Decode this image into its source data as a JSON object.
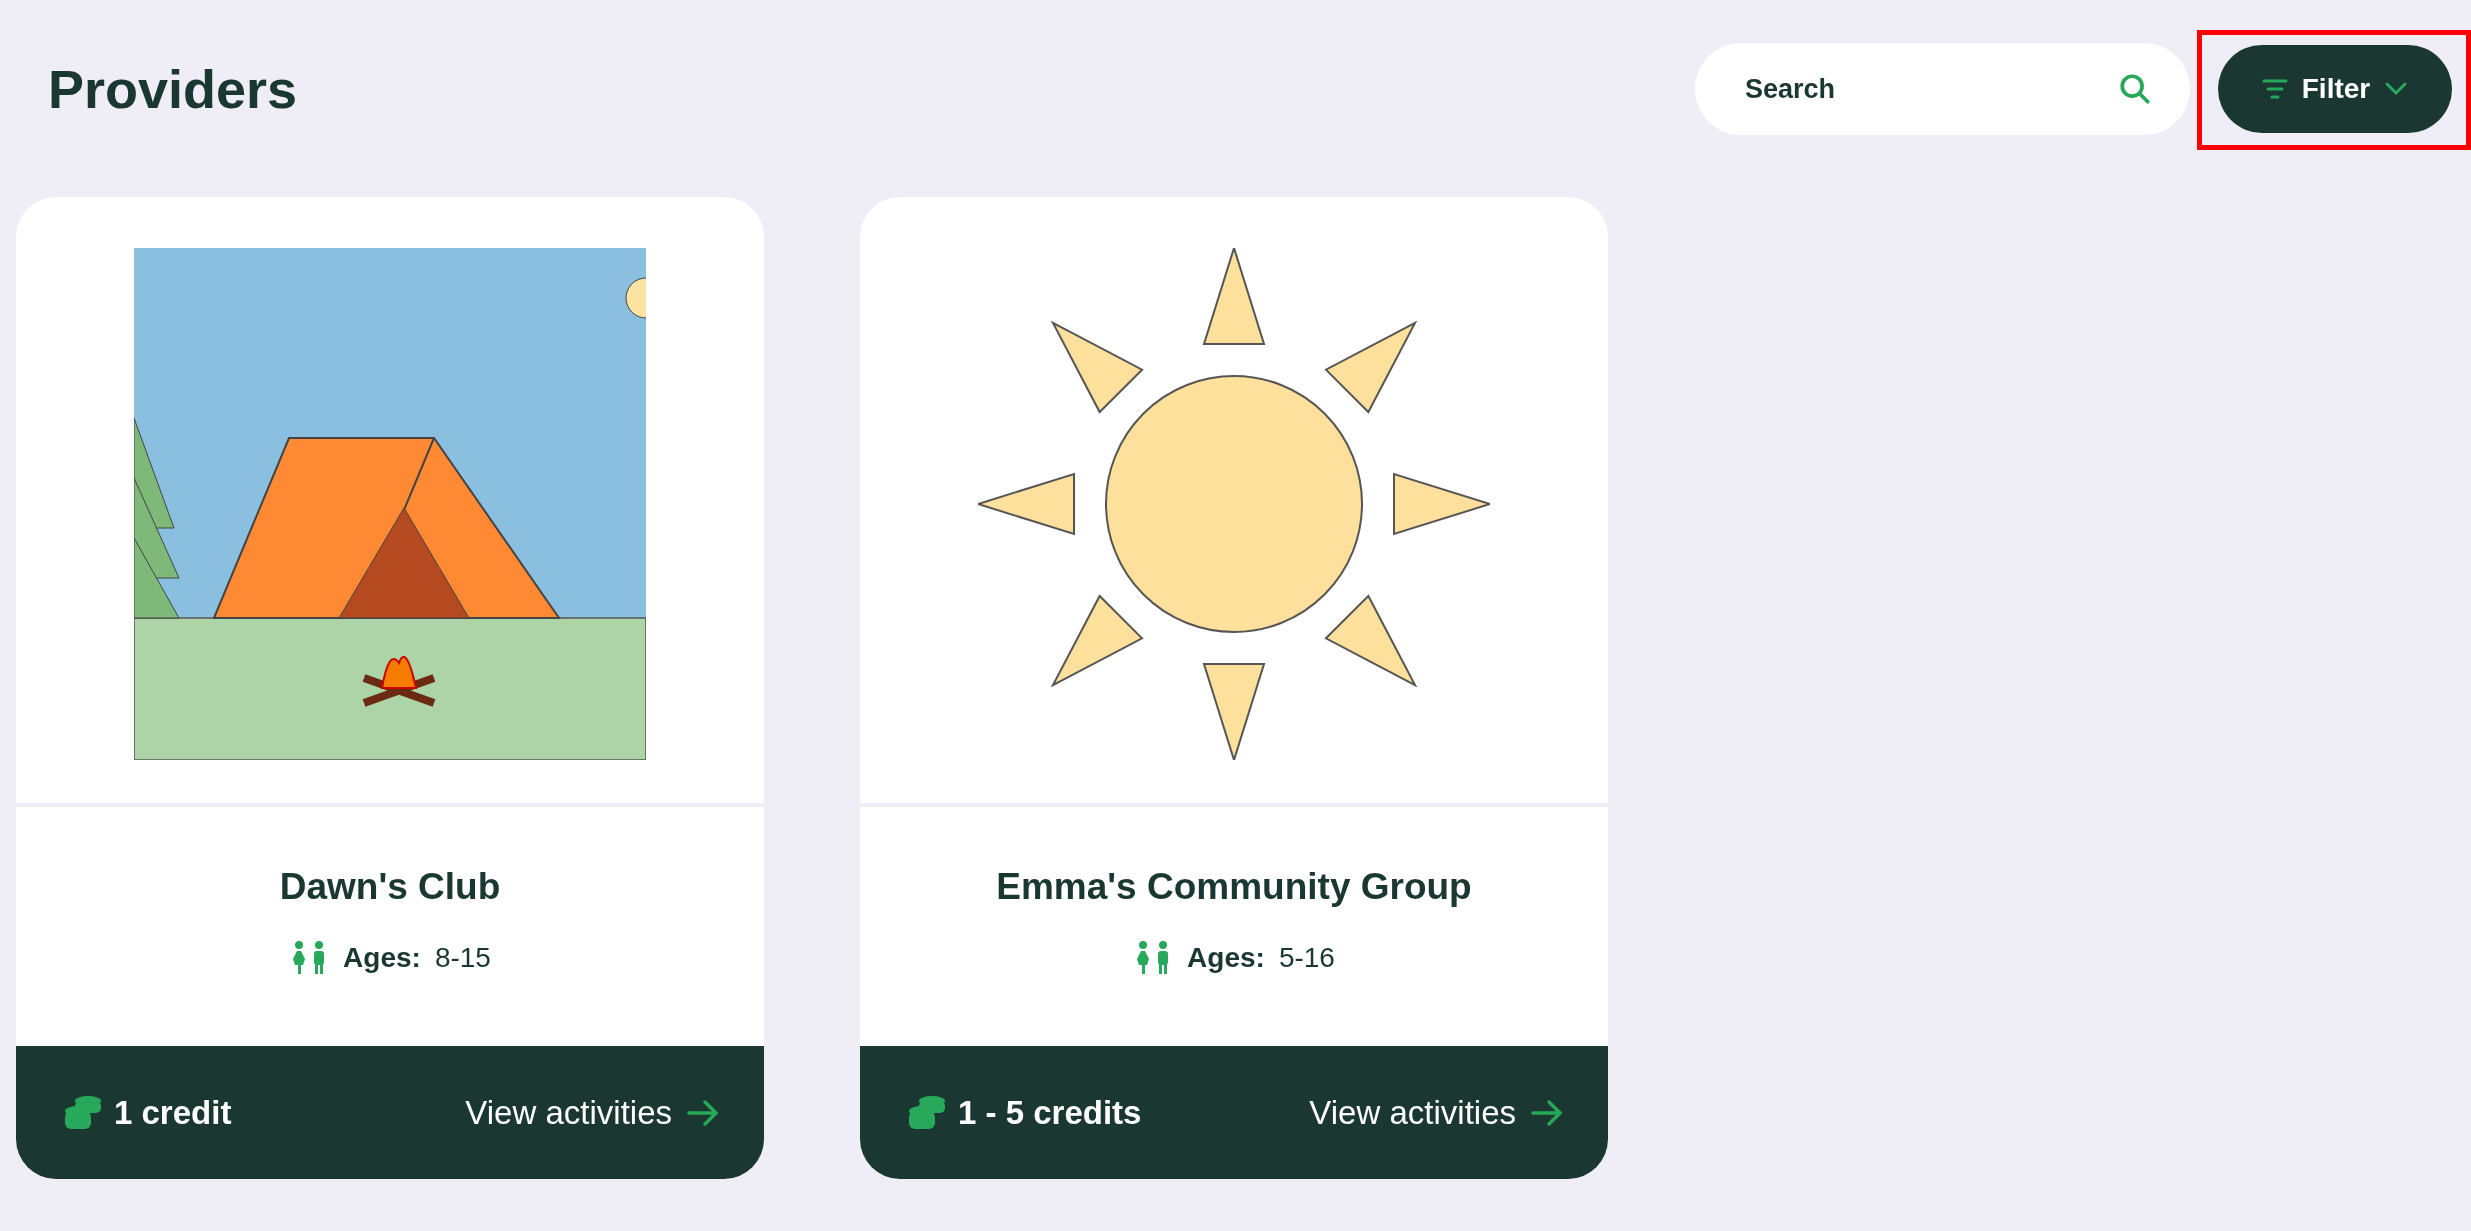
{
  "page": {
    "title": "Providers"
  },
  "search": {
    "placeholder": "Search"
  },
  "filter": {
    "label": "Filter",
    "highlighted": true
  },
  "providers": [
    {
      "name": "Dawn's Club",
      "image": {
        "kind": "campsite"
      },
      "ages_label": "Ages:",
      "ages": "8-15",
      "credits": "1 credit",
      "link": "View activities"
    },
    {
      "name": "Emma's Community Group",
      "image": {
        "kind": "sun"
      },
      "ages_label": "Ages:",
      "ages": "5-16",
      "credits": "1 - 5 credits",
      "link": "View activities"
    }
  ]
}
